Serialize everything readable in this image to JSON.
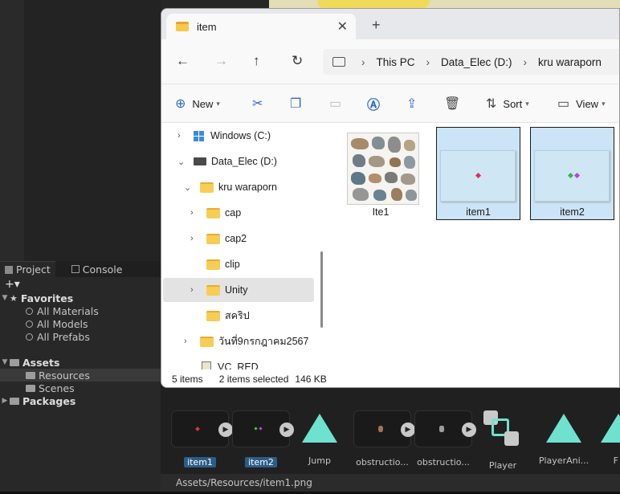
{
  "unity": {
    "project_panel": {
      "tabs": [
        {
          "label": "Project"
        },
        {
          "label": "Console"
        }
      ],
      "add_button": "+▾",
      "tree": {
        "favorites": "Favorites",
        "all_materials": "All Materials",
        "all_models": "All Models",
        "all_prefabs": "All Prefabs",
        "assets": "Assets",
        "resources": "Resources",
        "scenes": "Scenes",
        "packages": "Packages"
      }
    },
    "asset_strip": [
      {
        "label": "item1",
        "selected": true,
        "icon": "sprite-thumbnail"
      },
      {
        "label": "item2",
        "selected": true,
        "icon": "sprite-thumbnail"
      },
      {
        "label": "Jump",
        "selected": false,
        "icon": "animation-clip-icon"
      },
      {
        "label": "obstructio...",
        "selected": false,
        "icon": "sprite-thumbnail"
      },
      {
        "label": "obstructio...",
        "selected": false,
        "icon": "sprite-thumbnail"
      },
      {
        "label": "Player",
        "selected": false,
        "icon": "prefab-icon"
      },
      {
        "label": "PlayerAni...",
        "selected": false,
        "icon": "animation-clip-icon"
      },
      {
        "label": "F",
        "selected": false,
        "icon": "animation-clip-icon"
      }
    ],
    "status_path": "Assets/Resources/item1.png"
  },
  "explorer": {
    "tab_title": "item",
    "new_tab": "+",
    "address": [
      "This PC",
      "Data_Elec (D:)",
      "kru waraporn"
    ],
    "commands": {
      "new": "New",
      "sort": "Sort",
      "view": "View"
    },
    "nav_tree": [
      {
        "label": "Windows (C:)",
        "icon": "windows-drive-icon",
        "expander": "collapsed"
      },
      {
        "label": "Data_Elec (D:)",
        "icon": "drive-icon",
        "expander": "expanded"
      },
      {
        "label": "kru waraporn",
        "icon": "folder-icon",
        "expander": "expanded"
      },
      {
        "label": "cap",
        "icon": "folder-icon",
        "expander": "collapsed"
      },
      {
        "label": "cap2",
        "icon": "folder-icon",
        "expander": "collapsed"
      },
      {
        "label": "clip",
        "icon": "folder-icon",
        "expander": "none"
      },
      {
        "label": "Unity",
        "icon": "folder-icon",
        "expander": "collapsed",
        "selected": true
      },
      {
        "label": "สคริป",
        "icon": "folder-icon",
        "expander": "none"
      },
      {
        "label": "วันที่9กรกฎาคม2567",
        "icon": "folder-icon",
        "expander": "collapsed"
      },
      {
        "label": "VC_RED",
        "icon": "file-icon",
        "expander": "none"
      }
    ],
    "files": [
      {
        "name": "Ite1",
        "selected": false,
        "icon": "rocks-image-thumbnail"
      },
      {
        "name": "item1",
        "selected": true,
        "icon": "red-gem-thumbnail"
      },
      {
        "name": "item2",
        "selected": true,
        "icon": "green-purple-gem-thumbnail"
      }
    ],
    "status": {
      "count": "5 items",
      "selected": "2 items selected",
      "size": "146 KB"
    }
  }
}
